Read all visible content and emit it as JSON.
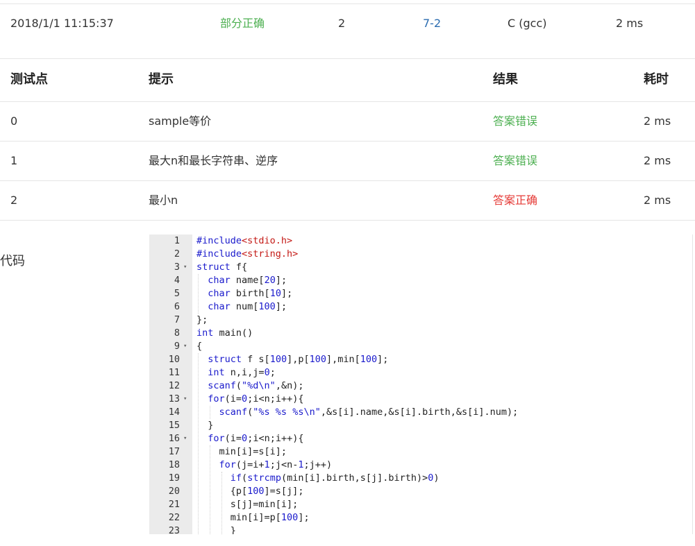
{
  "summary": {
    "time": "2018/1/1 11:15:37",
    "status": "部分正确",
    "score": "2",
    "problem": "7-2",
    "compiler": "C (gcc)",
    "runtime": "2 ms"
  },
  "cases_table": {
    "headers": {
      "case": "测试点",
      "hint": "提示",
      "result": "结果",
      "time": "耗时"
    },
    "rows": [
      {
        "case": "0",
        "hint": "sample等价",
        "result": "答案错误",
        "time": "2 ms",
        "result_color": "#4caf50"
      },
      {
        "case": "1",
        "hint": "最大n和最长字符串、逆序",
        "result": "答案错误",
        "time": "2 ms",
        "result_color": "#4caf50"
      },
      {
        "case": "2",
        "hint": "最小n",
        "result": "答案正确",
        "time": "2 ms",
        "result_color": "#e53935"
      }
    ]
  },
  "code_section": {
    "label": "代码",
    "lines": [
      "1",
      "2",
      "3",
      "4",
      "5",
      "6",
      "7",
      "8",
      "9",
      "10",
      "11",
      "12",
      "13",
      "14",
      "15",
      "16",
      "17",
      "18",
      "19",
      "20",
      "21",
      "22",
      "23"
    ]
  },
  "colors": {
    "green": "#4caf50",
    "red": "#e53935",
    "link": "#2b6cb0",
    "keyword": "#1a1acc",
    "include_header": "#c41a16"
  },
  "icons": [
    "fold-arrow-icon"
  ]
}
